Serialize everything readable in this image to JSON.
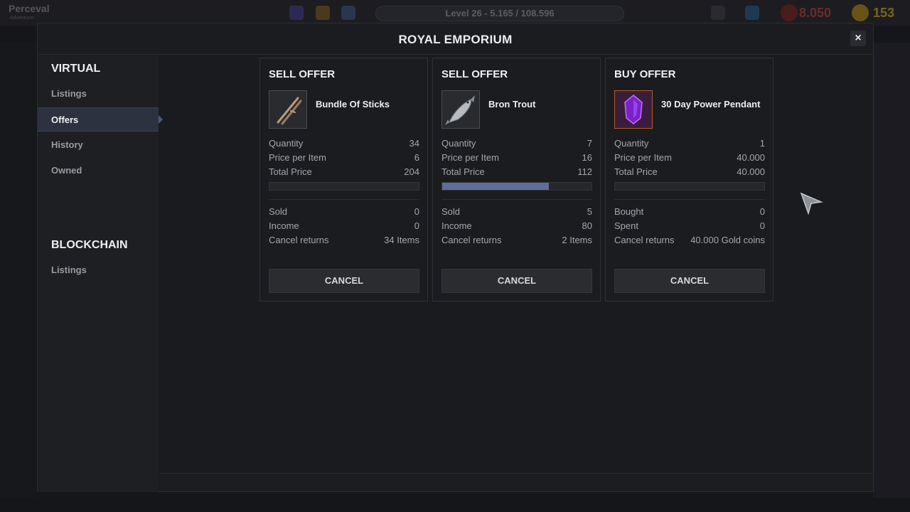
{
  "hud": {
    "player_name": "Perceval",
    "player_sub": "Adventurer",
    "level_text": "Level 26 - 5.165 / 108.596",
    "level_progress": 0.048,
    "red_currency": "8.050",
    "gold_currency": "153"
  },
  "window": {
    "title": "ROYAL EMPORIUM",
    "close_label": "×"
  },
  "sidebar": {
    "virtual_header": "VIRTUAL",
    "virtual_items": [
      "Listings",
      "Offers",
      "History",
      "Owned"
    ],
    "active_item": "Offers",
    "blockchain_header": "BLOCKCHAIN",
    "blockchain_items": [
      "Listings"
    ]
  },
  "offers": [
    {
      "type": "SELL OFFER",
      "item_name": "Bundle Of Sticks",
      "icon": "sticks-icon",
      "rows_top": [
        {
          "label": "Quantity",
          "value": "34"
        },
        {
          "label": "Price per Item",
          "value": "6"
        },
        {
          "label": "Total Price",
          "value": "204"
        }
      ],
      "progress": 0.0,
      "rows_bottom": [
        {
          "label": "Sold",
          "value": "0"
        },
        {
          "label": "Income",
          "value": "0"
        },
        {
          "label": "Cancel returns",
          "value": "34 Items"
        }
      ],
      "cancel_label": "CANCEL"
    },
    {
      "type": "SELL OFFER",
      "item_name": "Bron Trout",
      "icon": "fish-icon",
      "rows_top": [
        {
          "label": "Quantity",
          "value": "7"
        },
        {
          "label": "Price per Item",
          "value": "16"
        },
        {
          "label": "Total Price",
          "value": "112"
        }
      ],
      "progress": 0.714,
      "rows_bottom": [
        {
          "label": "Sold",
          "value": "5"
        },
        {
          "label": "Income",
          "value": "80"
        },
        {
          "label": "Cancel returns",
          "value": "2 Items"
        }
      ],
      "cancel_label": "CANCEL"
    },
    {
      "type": "BUY OFFER",
      "item_name": "30 Day Power Pendant",
      "icon": "pendant-icon",
      "rows_top": [
        {
          "label": "Quantity",
          "value": "1"
        },
        {
          "label": "Price per Item",
          "value": "40.000"
        },
        {
          "label": "Total Price",
          "value": "40.000"
        }
      ],
      "progress": 0.0,
      "rows_bottom": [
        {
          "label": "Bought",
          "value": "0"
        },
        {
          "label": "Spent",
          "value": "0"
        },
        {
          "label": "Cancel returns",
          "value": "40.000 Gold coins"
        }
      ],
      "cancel_label": "CANCEL"
    }
  ],
  "colors": {
    "accent": "#5e6e9c",
    "active_item_bg": "#2d3240",
    "pendant_purple": "#8a2bd6"
  }
}
